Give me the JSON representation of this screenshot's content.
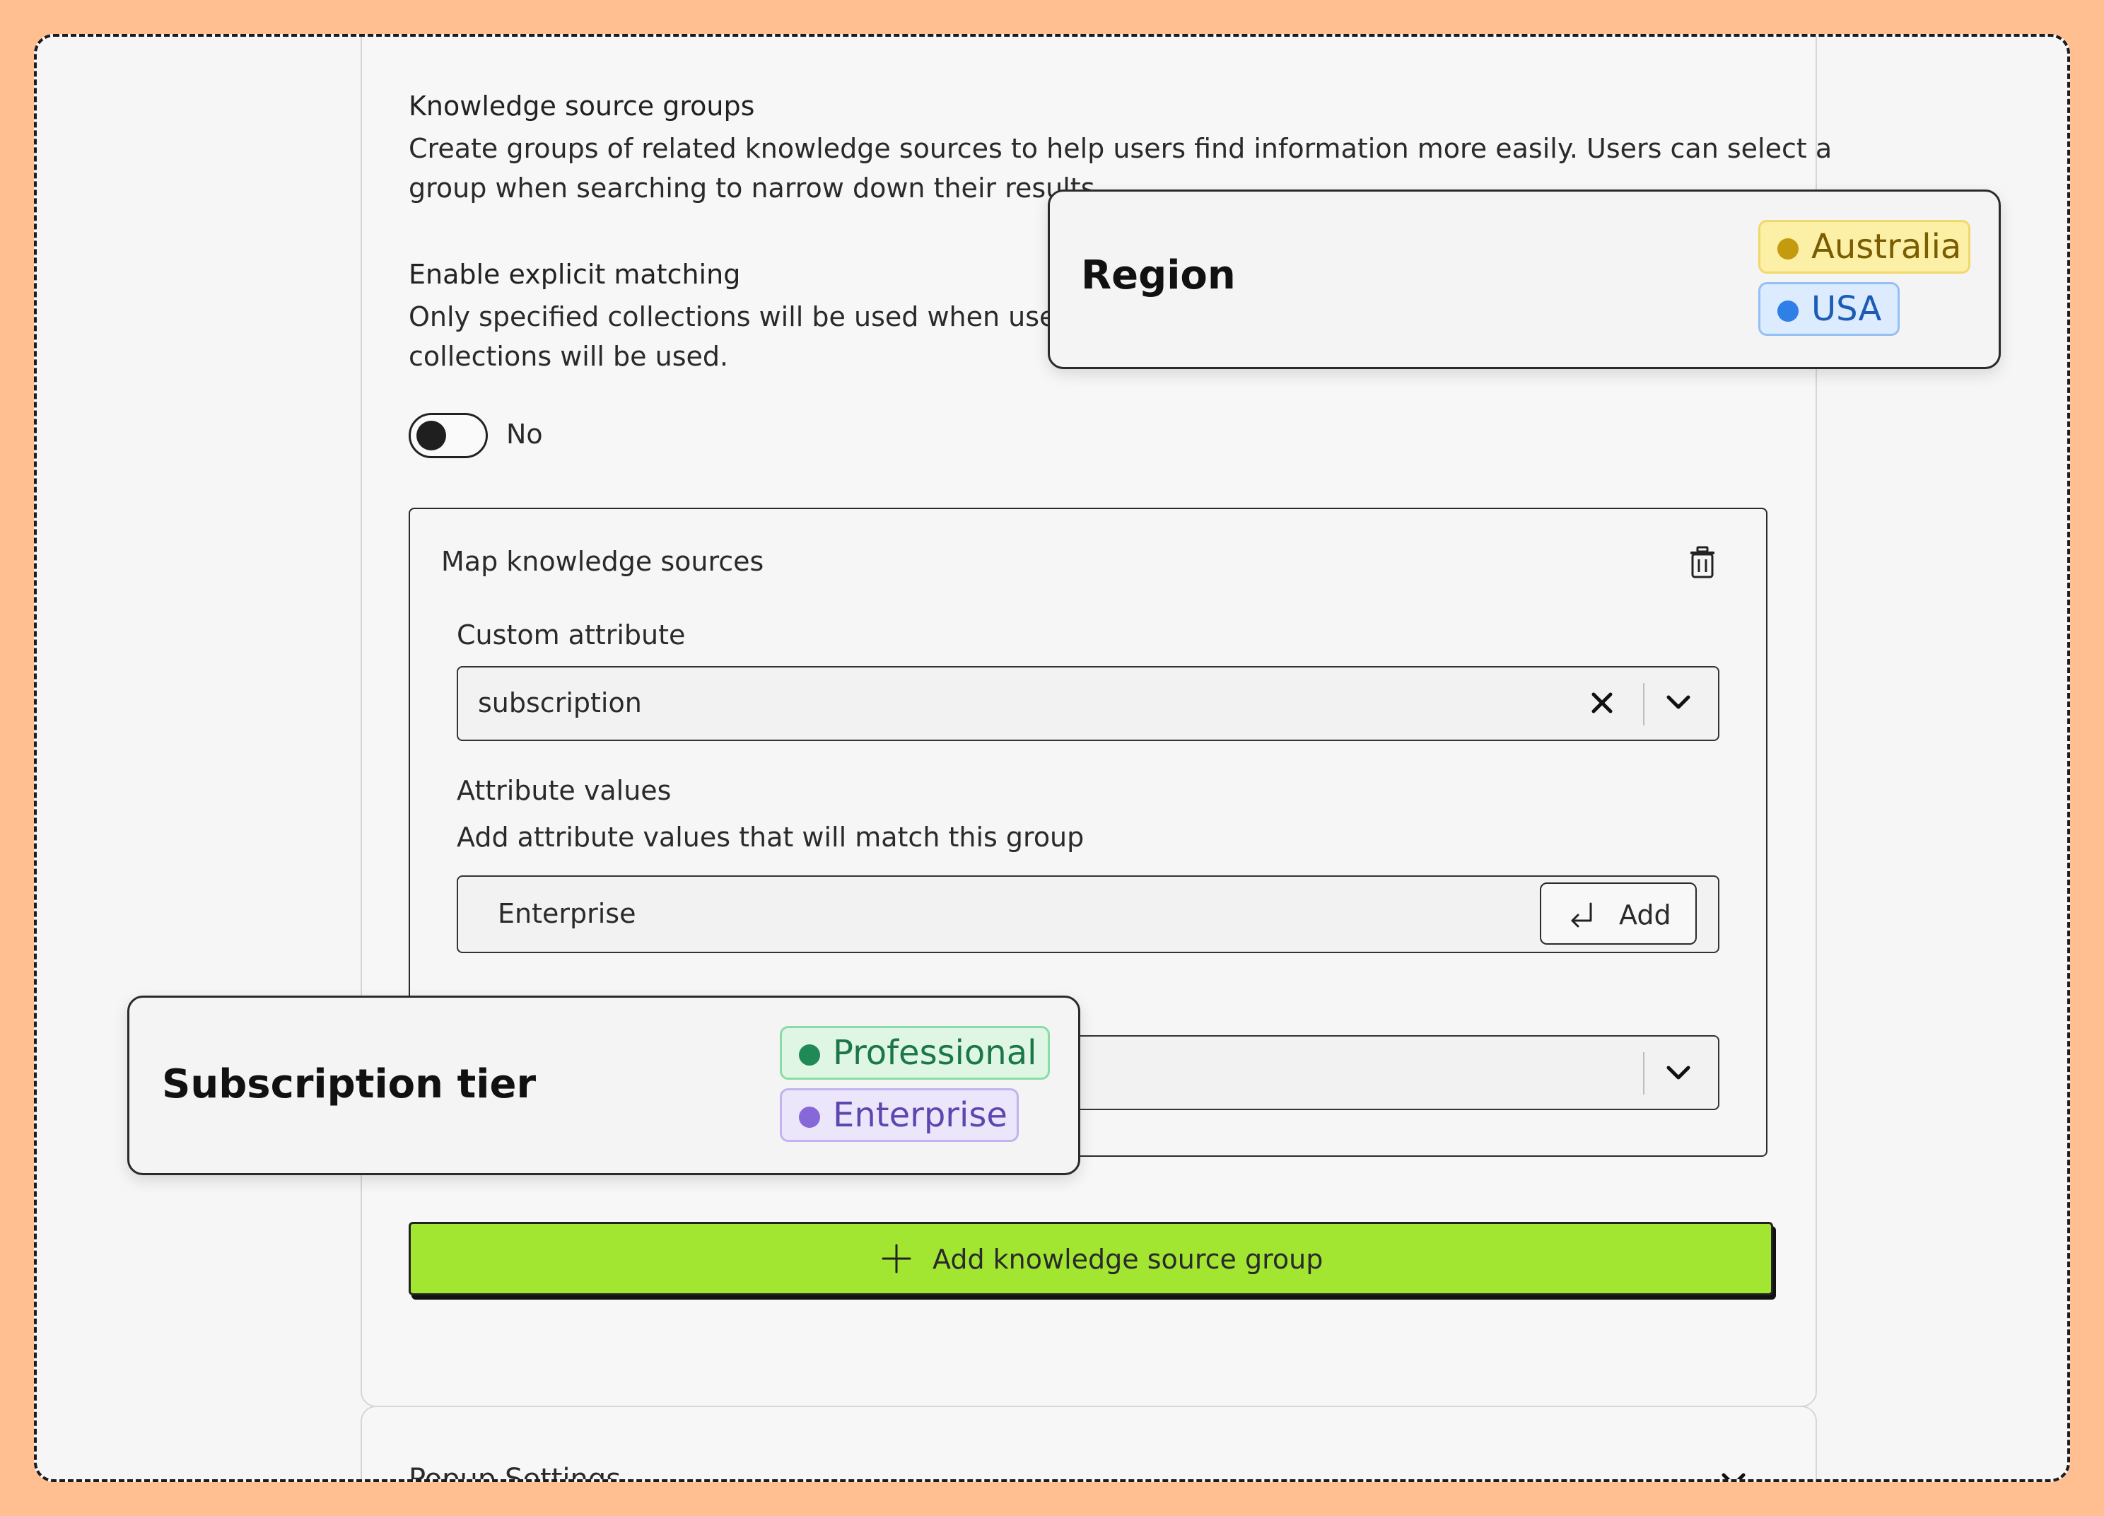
{
  "knowledge_groups": {
    "title": "Knowledge source groups",
    "desc_line1": "Create groups of related knowledge sources to help users find information more easily. Users can select a",
    "desc_line2": "group when searching to narrow down their results."
  },
  "explicit_matching": {
    "title": "Enable explicit matching",
    "desc_line1": "Only specified collections will be used when user at",
    "desc_line2": "collections will be used.",
    "toggle_label": "No"
  },
  "map_card": {
    "title": "Map knowledge sources",
    "custom_attribute_label": "Custom attribute",
    "custom_attribute_value": "subscription",
    "attribute_values_label": "Attribute values",
    "attribute_values_help": "Add attribute values that will match this group",
    "attribute_input_value": "Enterprise",
    "add_button_label": "Add"
  },
  "add_group_button": "Add knowledge source group",
  "popup_settings_label": "Popup Settings",
  "region_popover": {
    "title": "Region",
    "chips": [
      {
        "label": "Australia",
        "color": "#c49a0e"
      },
      {
        "label": "USA",
        "color": "#2f7fe8"
      }
    ]
  },
  "subscription_popover": {
    "title": "Subscription tier",
    "chips": [
      {
        "label": "Professional",
        "color": "#1f8a55"
      },
      {
        "label": "Enterprise",
        "color": "#8768d8"
      }
    ]
  },
  "icons": [
    "trash-icon",
    "close-icon",
    "chevron-down-icon",
    "enter-icon",
    "plus-icon"
  ]
}
